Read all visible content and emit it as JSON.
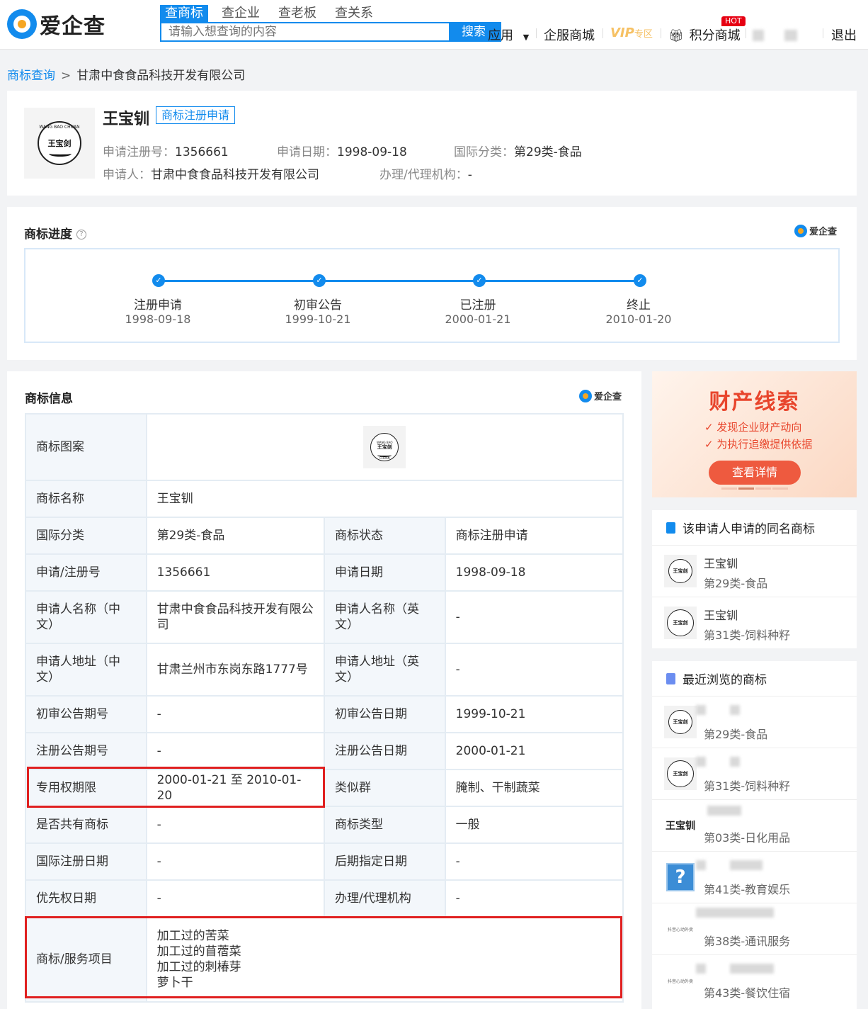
{
  "header": {
    "brand": "爱企查",
    "search_tabs": [
      "查商标",
      "查企业",
      "查老板",
      "查关系"
    ],
    "search_placeholder": "请输入想查询的内容",
    "search_button": "搜索",
    "nav": {
      "apps": "应用",
      "enterprise_mall": "企服商城",
      "vip": "VIP",
      "vip_zone": "专区",
      "points_mall": "积分商城",
      "hot_badge": "HOT",
      "logout": "退出"
    }
  },
  "breadcrumb": {
    "root": "商标查询",
    "separator": ">",
    "current": "甘肃中食食品科技开发有限公司"
  },
  "summary": {
    "emblem_text": "王宝剑",
    "emblem_arc": "WANG BAO CHUAN",
    "name": "王宝钏",
    "status_tag": "商标注册申请",
    "reg_no_label": "申请注册号：",
    "reg_no": "1356661",
    "apply_date_label": "申请日期：",
    "apply_date": "1998-09-18",
    "intl_class_label": "国际分类：",
    "intl_class": "第29类-食品",
    "applicant_label": "申请人：",
    "applicant": "甘肃中食食品科技开发有限公司",
    "agent_label": "办理/代理机构：",
    "agent": "-"
  },
  "progress": {
    "title": "商标进度",
    "help_icon": "?",
    "brand": "爱企查",
    "steps": [
      {
        "name": "注册申请",
        "date": "1998-09-18"
      },
      {
        "name": "初审公告",
        "date": "1999-10-21"
      },
      {
        "name": "已注册",
        "date": "2000-01-21"
      },
      {
        "name": "终止",
        "date": "2010-01-20"
      }
    ]
  },
  "info": {
    "title": "商标信息",
    "brand": "爱企查",
    "image_label": "商标图案",
    "name_label": "商标名称",
    "name_value": "王宝钏",
    "rows": [
      {
        "k1": "国际分类",
        "v1": "第29类-食品",
        "k2": "商标状态",
        "v2": "商标注册申请"
      },
      {
        "k1": "申请/注册号",
        "v1": "1356661",
        "k2": "申请日期",
        "v2": "1998-09-18"
      },
      {
        "k1": "申请人名称（中文）",
        "v1": "甘肃中食食品科技开发有限公司",
        "k2": "申请人名称（英文）",
        "v2": "-"
      },
      {
        "k1": "申请人地址（中文）",
        "v1": "甘肃兰州市东岗东路1777号",
        "k2": "申请人地址（英文）",
        "v2": "-"
      },
      {
        "k1": "初审公告期号",
        "v1": "-",
        "k2": "初审公告日期",
        "v2": "1999-10-21"
      },
      {
        "k1": "注册公告期号",
        "v1": "-",
        "k2": "注册公告日期",
        "v2": "2000-01-21"
      },
      {
        "k1": "专用权期限",
        "v1": "2000-01-21 至 2010-01-20",
        "k2": "类似群",
        "v2": "腌制、干制蔬菜"
      },
      {
        "k1": "是否共有商标",
        "v1": "-",
        "k2": "商标类型",
        "v2": "一般"
      },
      {
        "k1": "国际注册日期",
        "v1": "-",
        "k2": "后期指定日期",
        "v2": "-"
      },
      {
        "k1": "优先权日期",
        "v1": "-",
        "k2": "办理/代理机构",
        "v2": "-"
      }
    ],
    "services_label": "商标/服务项目",
    "services": [
      "加工过的苦菜",
      "加工过的苜蓿菜",
      "加工过的刺椿芽",
      "萝卜干"
    ]
  },
  "promo": {
    "title": "财产线索",
    "line1": "✓ 发现企业财产动向",
    "line2": "✓ 为执行追缴提供依据",
    "button": "查看详情"
  },
  "same_name": {
    "title": "该申请人申请的同名商标",
    "items": [
      {
        "name": "王宝钏",
        "cls": "第29类-食品"
      },
      {
        "name": "王宝钏",
        "cls": "第31类-饲料种籽"
      }
    ]
  },
  "recent": {
    "title": "最近浏览的商标",
    "items": [
      {
        "cls": "第29类-食品"
      },
      {
        "cls": "第31类-饲料种籽"
      },
      {
        "thumb_text": "王宝钏",
        "cls": "第03类-日化用品"
      },
      {
        "thumb_text": "?",
        "cls": "第41类-教育娱乐"
      },
      {
        "thumb_text": "抖音心动外卖",
        "cls": "第38类-通讯服务"
      },
      {
        "thumb_text": "抖音心动外卖",
        "cls": "第43类-餐饮住宿"
      }
    ]
  },
  "colors": {
    "accent": "#128bed",
    "highlight": "#e02020",
    "promo": "#e8452c"
  }
}
